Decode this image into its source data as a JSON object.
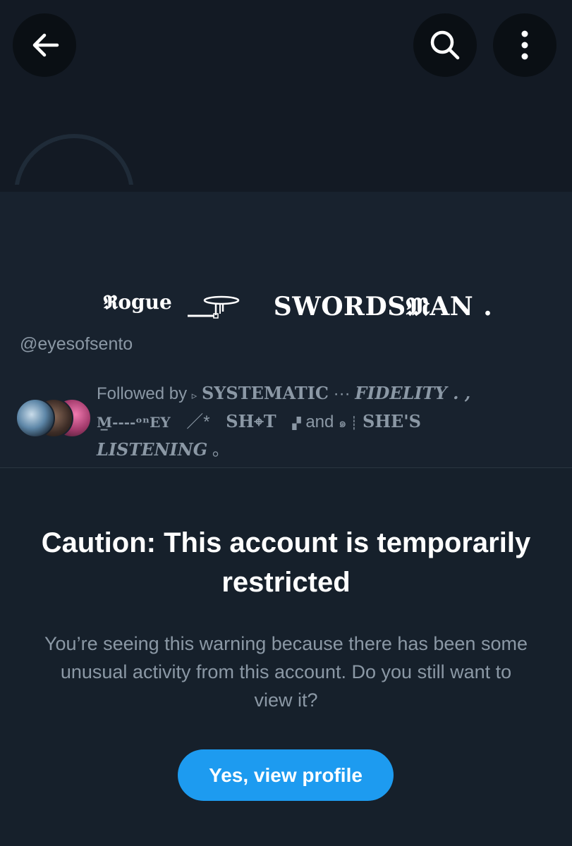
{
  "header": {
    "back_icon": "arrow-left-icon",
    "search_icon": "search-icon",
    "more_icon": "more-vertical-icon"
  },
  "profile": {
    "display_name_parts": [
      "𝕽ogue",
      "SWORDS𝕸AN",
      "."
    ],
    "name_glyph": "sword-symbol",
    "handle": "@eyesofsento",
    "followed_by": {
      "prefix": "Followed by",
      "segment_1_mark": "▹",
      "segment_1": "SYSTEMATIC",
      "segment_1_sep": "···",
      "segment_2": "FIDELITY . ,",
      "segment_3": "M̲----ᵒⁿEY",
      "segment_3_sep": "／*",
      "segment_4": "SH⌖T",
      "segment_4_mark": "▞",
      "and_text": "and",
      "segment_5_mark": "๑ ┊",
      "segment_5": "SHE'S",
      "segment_6": "LISTENING",
      "segment_6_tail": "。"
    }
  },
  "warning": {
    "title": "Caution: This account is temporarily restricted",
    "body": "You’re seeing this warning because there has been some unusual activity from this account. Do you still want to view it?",
    "button_label": "Yes, view profile"
  },
  "colors": {
    "background": "#15202b",
    "accent": "#1d9bf0",
    "secondary_text": "#8b98a5"
  }
}
